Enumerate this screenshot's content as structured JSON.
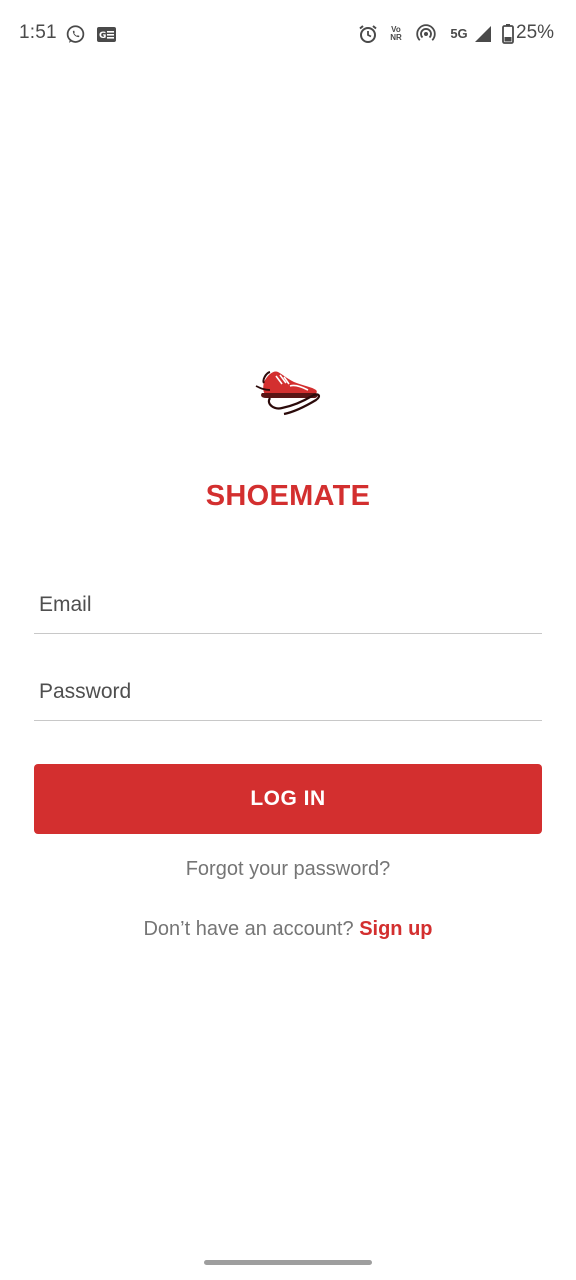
{
  "status_bar": {
    "time": "1:51",
    "battery_percent": "25%",
    "network": "5G",
    "volte_top": "Vo",
    "volte_bottom": "NR",
    "icons": [
      "whatsapp-icon",
      "news-icon",
      "alarm-icon",
      "volte-icon",
      "hotspot-icon",
      "5g-icon",
      "signal-icon",
      "battery-icon"
    ]
  },
  "app": {
    "name": "SHOEMATE",
    "logo": "shoe-logo",
    "brand_color": "#d32f2f"
  },
  "form": {
    "email_placeholder": "Email",
    "email_value": "",
    "password_placeholder": "Password",
    "password_value": "",
    "login_label": "LOG IN"
  },
  "links": {
    "forgot_password": "Forgot your password?",
    "no_account": "Don’t have an account?",
    "sign_up": "Sign up"
  }
}
